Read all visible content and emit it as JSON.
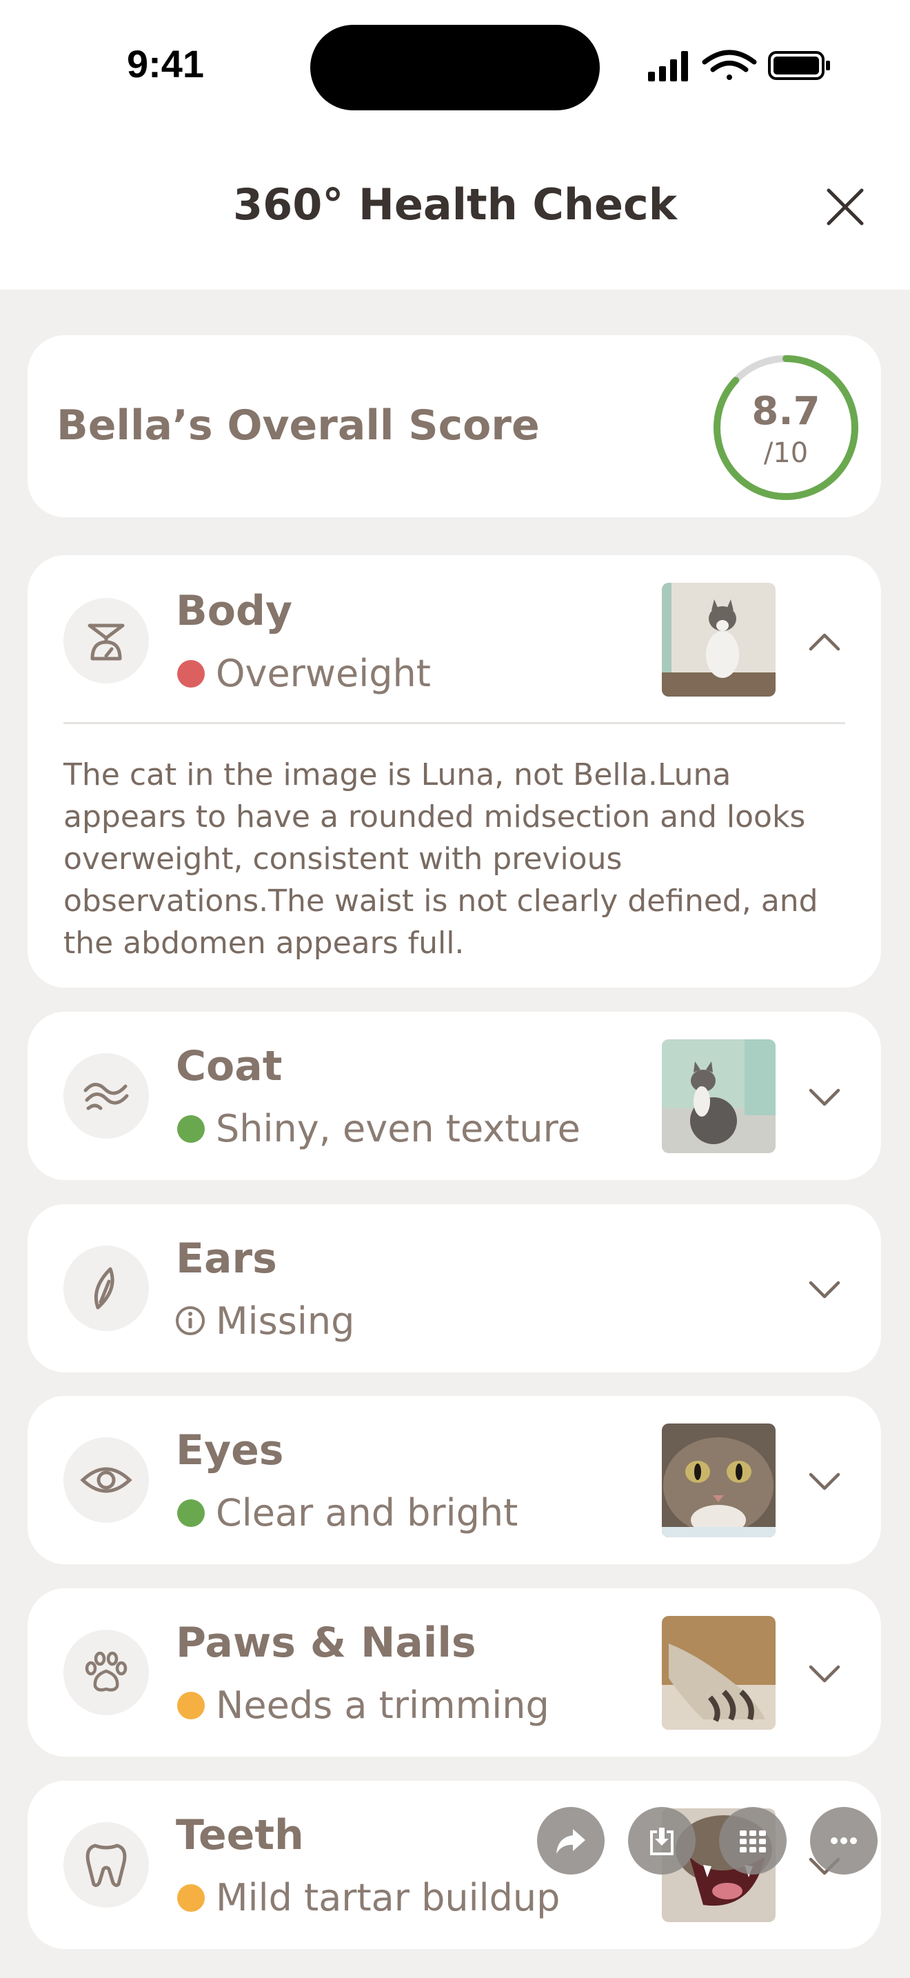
{
  "status_bar": {
    "time": "9:41"
  },
  "header": {
    "title": "360° Health Check"
  },
  "score_card": {
    "label": "Bella’s Overall Score",
    "score": "8.7",
    "out_of": "/10",
    "score_value": 8.7,
    "max": 10,
    "ring_color": "#6AA84F"
  },
  "categories": [
    {
      "title": "Body",
      "status": "Overweight",
      "status_color": "#DC6060",
      "icon": "scale-icon",
      "expanded": true,
      "description": "The cat in the image is Luna, not Bella.Luna appears to have a rounded midsection and looks overweight, consistent with previous observations.The waist is not clearly defined, and the abdomen appears full."
    },
    {
      "title": "Coat",
      "status": "Shiny, even texture",
      "status_color": "#6AA84F",
      "icon": "waves-icon",
      "expanded": false
    },
    {
      "title": "Ears",
      "status": "Missing",
      "status_color": "#8B7C73",
      "icon": "ear-icon",
      "expanded": false
    },
    {
      "title": "Eyes",
      "status": "Clear and bright",
      "status_color": "#6AA84F",
      "icon": "eye-icon",
      "expanded": false
    },
    {
      "title": "Paws & Nails",
      "status": "Needs a trimming",
      "status_color": "#F5B041",
      "icon": "paw-icon",
      "expanded": false
    },
    {
      "title": "Teeth",
      "status": "Mild tartar buildup",
      "status_color": "#F5B041",
      "icon": "tooth-icon",
      "expanded": false
    }
  ]
}
